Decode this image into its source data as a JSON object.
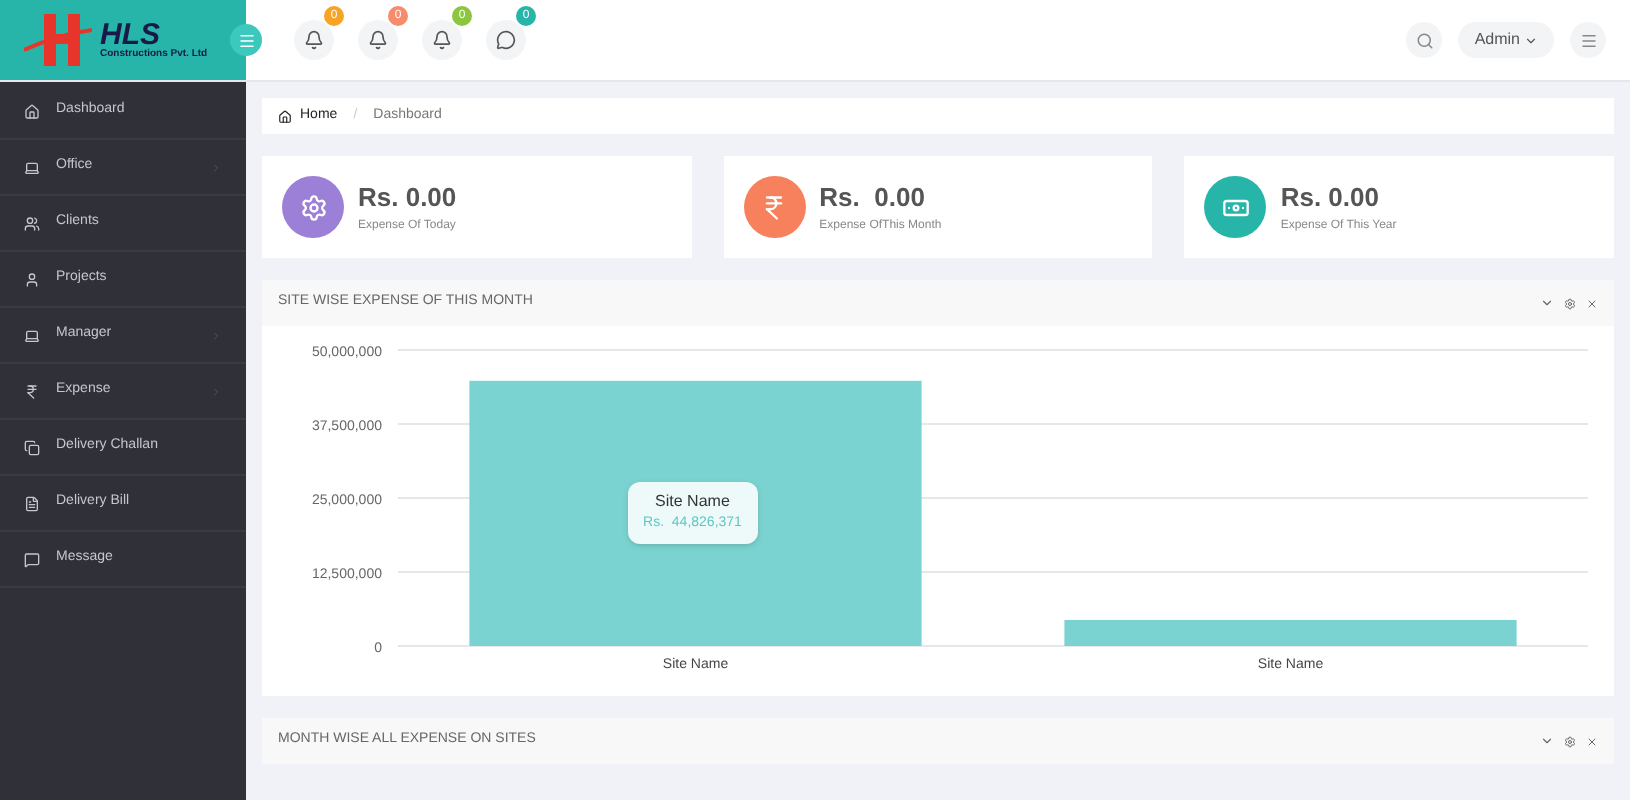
{
  "logo": {
    "name": "HLS",
    "tagline": "Constructions Pvt. Ltd"
  },
  "header": {
    "badges": [
      {
        "kind": "bell",
        "count": "0",
        "color": "#f7a325"
      },
      {
        "kind": "bell",
        "count": "0",
        "color": "#f78c6c"
      },
      {
        "kind": "bell",
        "count": "0",
        "color": "#8cc63f"
      },
      {
        "kind": "chat",
        "count": "0",
        "color": "#26b5a8"
      }
    ],
    "user": "Admin"
  },
  "sidebar": {
    "items": [
      {
        "label": "Dashboard",
        "has_submenu": false
      },
      {
        "label": "Office",
        "has_submenu": true
      },
      {
        "label": "Clients",
        "has_submenu": false
      },
      {
        "label": "Projects",
        "has_submenu": false
      },
      {
        "label": "Manager",
        "has_submenu": true
      },
      {
        "label": "Expense",
        "has_submenu": true
      },
      {
        "label": "Delivery Challan",
        "has_submenu": false
      },
      {
        "label": "Delivery Bill",
        "has_submenu": false
      },
      {
        "label": "Message",
        "has_submenu": false
      }
    ]
  },
  "breadcrumb": {
    "items": [
      "Home",
      "Dashboard"
    ],
    "separator": "/"
  },
  "stats": [
    {
      "color": "#9c7fd6",
      "value": "Rs. 0.00",
      "label": "Expense Of Today"
    },
    {
      "color": "#f7815c",
      "value": "Rs.  0.00",
      "label": "Expense OfThis Month"
    },
    {
      "color": "#26b5a8",
      "value": "Rs. 0.00",
      "label": "Expense Of This Year"
    }
  ],
  "panels": [
    {
      "title": "SITE WISE EXPENSE OF THIS MONTH",
      "tooltip": {
        "title": "Site Name",
        "value": "Rs.  44,826,371"
      },
      "chart_data": {
        "type": "bar",
        "categories": [
          "Site Name",
          "Site Name"
        ],
        "grid": true,
        "series": [
          {
            "color": "#7ad3d0",
            "values": [
              44800000,
              4400000
            ]
          }
        ],
        "ylim": [
          0,
          50000000
        ],
        "yticks": [
          {
            "value": 0,
            "label": "0"
          },
          {
            "value": 12500000,
            "label": "12,500,000"
          },
          {
            "value": 25000000,
            "label": "25,000,000"
          },
          {
            "value": 37500000,
            "label": "37,500,000"
          },
          {
            "value": 50000000,
            "label": "50,000,000"
          }
        ]
      }
    },
    {
      "title": "MONTH WISE ALL EXPENSE ON SITES"
    }
  ]
}
